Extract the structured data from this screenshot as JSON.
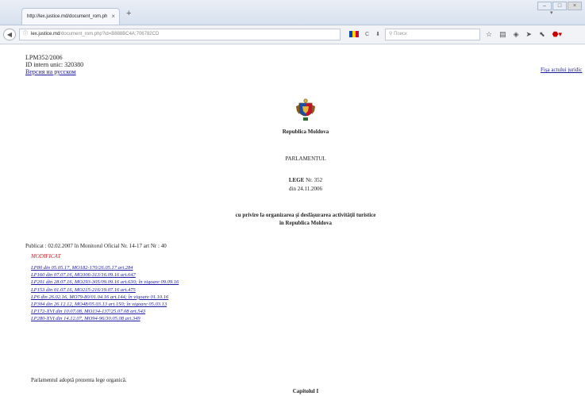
{
  "browser": {
    "tab_title": "http://lex.justice.md/document_rom.ph",
    "tab_close": "×",
    "new_tab": "+",
    "url_host": "lex.justice.md",
    "url_path": "/document_rom.php?id=B888BC4A:706782CD",
    "url_info_icon": "ⓘ",
    "search_placeholder": "Поиск",
    "back_glyph": "◀",
    "reload_glyph": "C",
    "download_glyph": "⬇",
    "colors": {
      "titlebar": "#dbe4f0",
      "link": "#1a1aa6",
      "modificat": "#d0202a"
    }
  },
  "document": {
    "code": "LPM352/2006",
    "id_label": "ID intern unic:",
    "id_value": "320380",
    "russian_link": "Версия на русском",
    "fisa_link": "Fişa actului juridic",
    "crest_alt": "Republica Moldova coat of arms",
    "country": "Republica Moldova",
    "parliament": "PARLAMENTUL",
    "lege_label": "LEGE",
    "lege_nr": "Nr. 352",
    "lege_date": "din 24.11.2006",
    "title_line1": "cu privire la organizarea şi desfăşurarea activităţii turistice",
    "title_line2": "în Republica Moldova",
    "publicat": "Publicat : 02.02.2007 în Monitorul Oficial Nr. 14-17     art Nr : 40",
    "modificat": "MODIFICAT",
    "modifications": [
      "LP80 din 05.05.17, MO182-170/26.05.17 art.284",
      "LP160 din 07.07.16, MO306-313/16.09.16 art.647",
      "LP201 din 28.07.16, MO293-305/09.09.16 art.630; în vigoare 09.09.16",
      "LP153 din 01.07.16, MO215-216/19.07.16 art.475",
      "LP6 din 26.02.16, MO79-80/01.04.16 art.144; în vigoare 01.10.16",
      "LP304 din 26.12.12, MO48/05.03.13 art.150; în vigoare 05.03.13",
      "LP172-XVI din 10.07.08, MO134-137/25.07.08 art.543",
      "LP280-XVI din 14.12.07, MO94-96/30.05.08 art.349"
    ],
    "adopta": "Parlamentul adoptă prezenta lege organică.",
    "capitol": "Capitolul I"
  }
}
